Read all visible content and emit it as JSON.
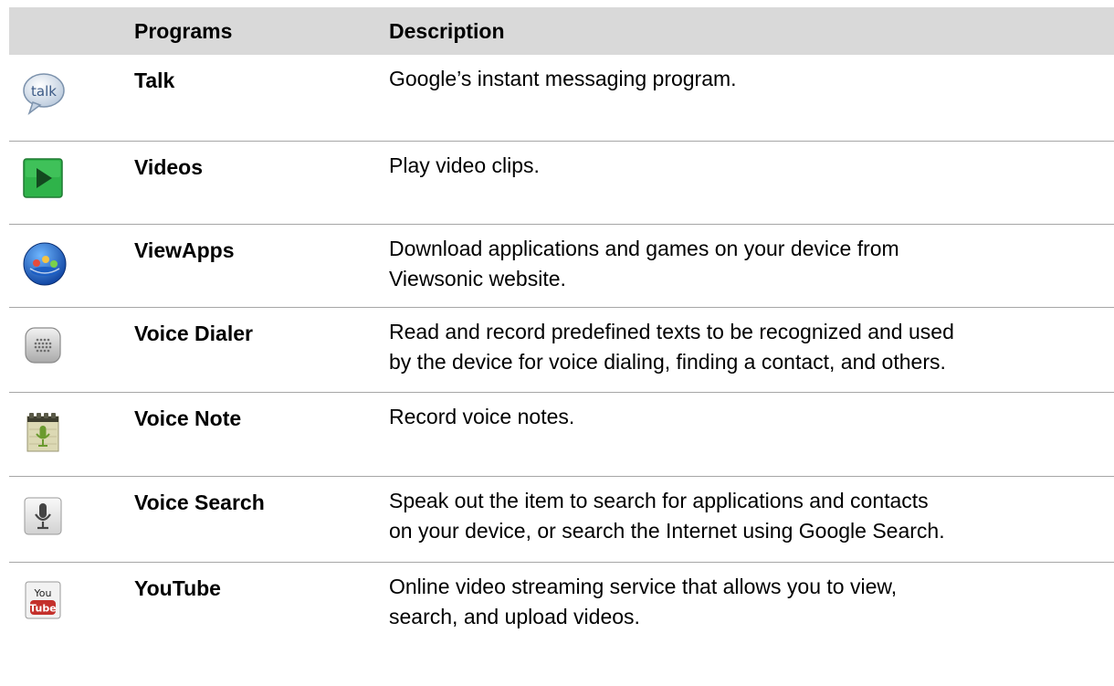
{
  "table": {
    "headers": {
      "programs": "Programs",
      "description": "Description"
    },
    "rows": [
      {
        "icon": "talk-icon",
        "icon_text": "talk",
        "name": "Talk",
        "description": [
          "Google’s instant messaging program."
        ]
      },
      {
        "icon": "videos-play-icon",
        "name": "Videos",
        "description": [
          "Play video clips."
        ]
      },
      {
        "icon": "viewapps-globe-icon",
        "name": "ViewApps",
        "description": [
          "Download applications and games on your device from",
          "Viewsonic website."
        ]
      },
      {
        "icon": "voice-dialer-icon",
        "name": "Voice Dialer",
        "description": [
          "Read and record predefined texts to be recognized and used",
          "by the device for voice dialing, finding a contact, and others."
        ]
      },
      {
        "icon": "voice-note-icon",
        "name": "Voice Note",
        "description": [
          "Record voice notes."
        ]
      },
      {
        "icon": "voice-search-microphone-icon",
        "name": "Voice Search",
        "description": [
          "Speak out the item to search for applications and contacts",
          "on your device, or search the Internet using Google Search."
        ]
      },
      {
        "icon": "youtube-icon",
        "icon_text_top": "You",
        "icon_text_bottom": "Tube",
        "name": "YouTube",
        "description": [
          "Online video streaming service that allows you to view,",
          "search, and upload videos."
        ]
      }
    ]
  },
  "colors": {
    "header_background": "#d9d9d9",
    "row_divider": "#a6a6a6",
    "videos_green": "#2fb34a",
    "youtube_red": "#c4302b"
  }
}
